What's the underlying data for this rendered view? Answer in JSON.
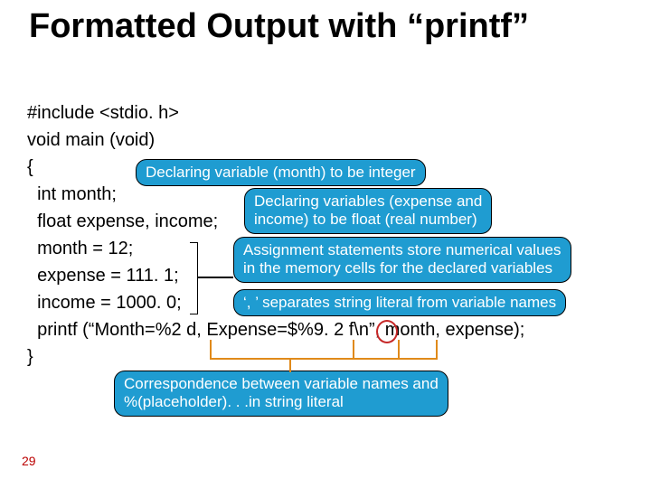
{
  "title": "Formatted Output with “printf”",
  "code": {
    "l1": "#include <stdio. h>",
    "l2": "void main (void)",
    "l3": "{",
    "l4": "  int month;",
    "l5": "  float expense, income;",
    "l6": "  month = 12;",
    "l7": "  expense = 111. 1;",
    "l8": "  income = 1000. 0;",
    "l9": "  printf (“Month=%2 d, Expense=$%9. 2 f\\n”, month, expense);",
    "l10": "}"
  },
  "callouts": {
    "c1": "Declaring  variable (month) to be integer",
    "c2": "Declaring  variables (expense and\nincome) to be float (real number)",
    "c3": "Assignment statements store numerical values\nin the memory cells for the declared variables",
    "c4": "‘, ’ separates string literal from variable names",
    "c5": "Correspondence between variable names and\n%(placeholder). . .in string literal"
  },
  "page_number": "29"
}
